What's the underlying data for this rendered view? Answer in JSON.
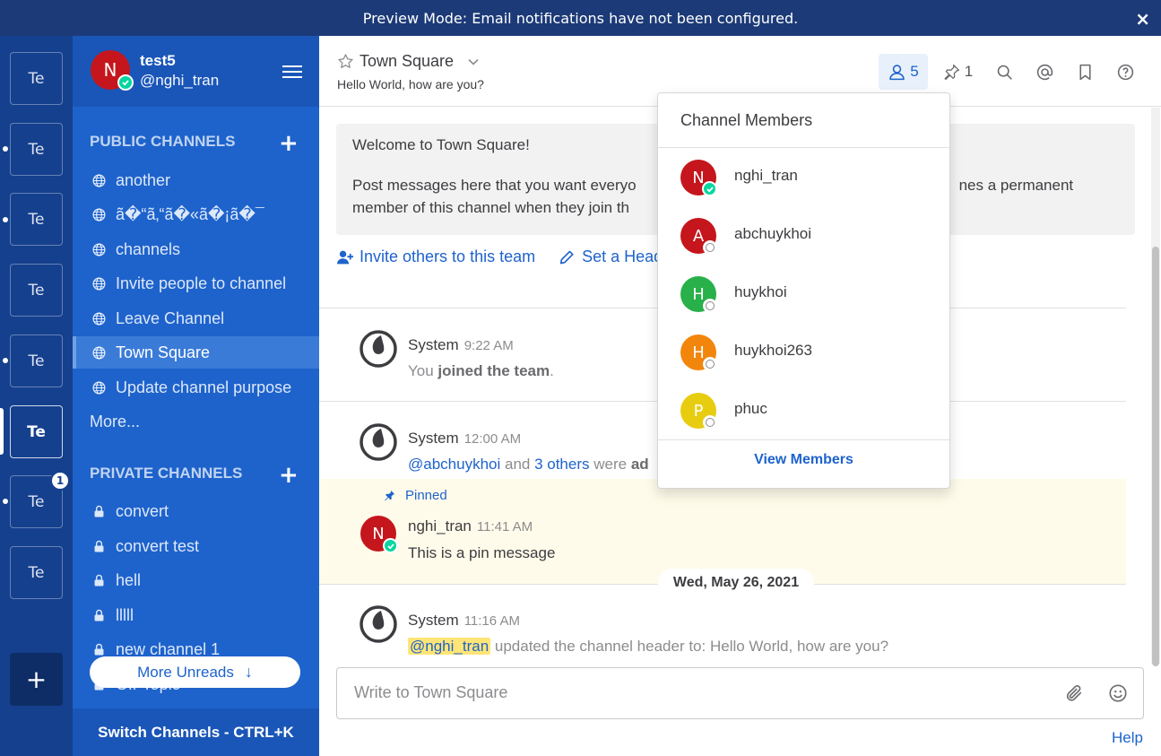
{
  "banner": {
    "text": "Preview Mode: Email notifications have not been configured.",
    "close": "×"
  },
  "teams": [
    {
      "label": "Te",
      "unread": false,
      "active": false
    },
    {
      "label": "Te",
      "unread": true,
      "active": false
    },
    {
      "label": "Te",
      "unread": true,
      "active": false
    },
    {
      "label": "Te",
      "unread": false,
      "active": false
    },
    {
      "label": "Te",
      "unread": true,
      "active": false
    },
    {
      "label": "Te",
      "unread": false,
      "active": true
    },
    {
      "label": "Te",
      "unread": true,
      "active": false,
      "badge": "1"
    },
    {
      "label": "Te",
      "unread": false,
      "active": false
    }
  ],
  "team_add": "+",
  "user": {
    "initial": "N",
    "name": "test5",
    "handle": "@nghi_tran"
  },
  "public_channels": {
    "title": "PUBLIC CHANNELS",
    "add": "+",
    "items": [
      {
        "label": "another"
      },
      {
        "label": "ã�“ã‚“ã�«ã�¡ã�¯"
      },
      {
        "label": "channels"
      },
      {
        "label": "Invite people to channel"
      },
      {
        "label": "Leave Channel"
      },
      {
        "label": "Town Square",
        "active": true
      },
      {
        "label": "Update channel purpose"
      }
    ],
    "more": "More..."
  },
  "private_channels": {
    "title": "PRIVATE CHANNELS",
    "add": "+",
    "items": [
      {
        "label": "convert"
      },
      {
        "label": "convert test"
      },
      {
        "label": "hell"
      },
      {
        "label": "lllll"
      },
      {
        "label": "new channel 1"
      },
      {
        "label": "Off-Topic"
      }
    ]
  },
  "more_unreads": "More Unreads",
  "switch_channels": "Switch Channels - CTRL+K",
  "channel": {
    "name": "Town Square",
    "purpose": "Hello World, how are you?",
    "member_count": "5",
    "pinned_count": "1"
  },
  "intro": {
    "heading_fragment": "",
    "title": "Welcome to Town Square!",
    "body_part1": "Post messages here that you want everyo",
    "body_part2": "nes a permanent",
    "body_line2": "member of this channel when they join th",
    "invite": "Invite others to this team",
    "set_header": "Set a Head"
  },
  "posts": [
    {
      "author": "System",
      "time": "9:22 AM",
      "text_pre": "You ",
      "text_bold": "joined the team",
      "text_post": "."
    },
    {
      "author": "System",
      "time": "12:00 AM",
      "mention": "@abchuykhoi",
      "mid": " and ",
      "others": "3 others",
      "tail": " were ",
      "tail_bold": "ad"
    },
    {
      "pinned": "Pinned",
      "author": "nghi_tran",
      "initial": "N",
      "time": "11:41 AM",
      "text": "This is a pin message"
    },
    {
      "author": "System",
      "time": "11:16 AM",
      "mention": "@nghi_tran",
      "text": " updated the channel header to: Hello World, how are you?"
    }
  ],
  "date_separator": "Wed, May 26, 2021",
  "composer": {
    "placeholder": "Write to Town Square"
  },
  "help": "Help",
  "members_popover": {
    "title": "Channel Members",
    "members": [
      {
        "initial": "N",
        "name": "nghi_tran",
        "color": "#c4161c",
        "status": "online"
      },
      {
        "initial": "A",
        "name": "abchuykhoi",
        "color": "#c4161c",
        "status": "offline"
      },
      {
        "initial": "H",
        "name": "huykhoi",
        "color": "#28b04a",
        "status": "offline"
      },
      {
        "initial": "H",
        "name": "huykhoi263",
        "color": "#f2860c",
        "status": "offline"
      },
      {
        "initial": "P",
        "name": "phuc",
        "color": "#e8cc10",
        "status": "offline"
      }
    ],
    "view_members": "View Members"
  }
}
